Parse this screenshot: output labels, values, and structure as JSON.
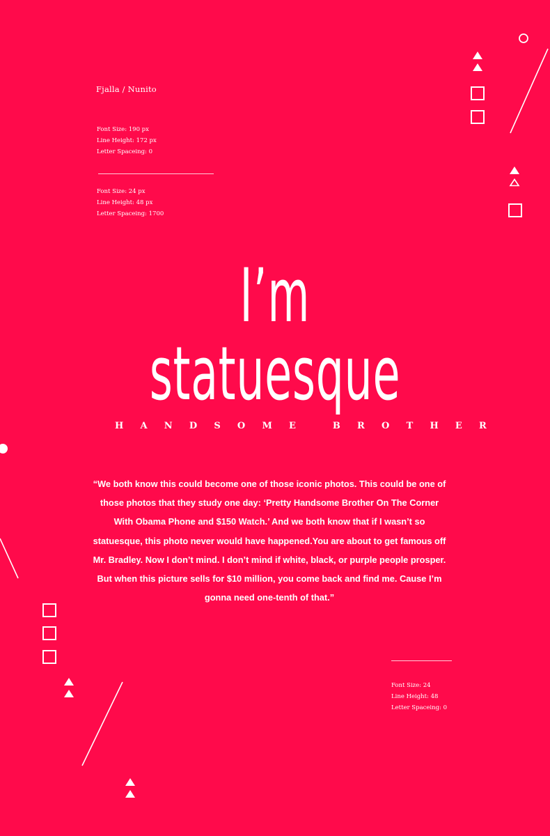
{
  "font_pair": "Fjalla / Nunito",
  "specs": {
    "headline": [
      "Font Size: 190 px",
      "Line Height: 172 px",
      "Letter Spaceing: 0"
    ],
    "subtitle": [
      "Font Size: 24 px",
      "Line Height: 48 px",
      "Letter Spaceing: 1700"
    ],
    "body": [
      "Font Size: 24",
      "Line Height: 48",
      "Letter Spaceing: 0"
    ]
  },
  "headline": {
    "line1": "I’m",
    "line2": "statuesque"
  },
  "subtitle": "HANDSOME BROTHER",
  "quote": "“We both know this could become one of those iconic photos. This could be one of those photos that they study one day: ‘Pretty Handsome Brother On The Corner With Obama Phone and $150 Watch.’ And we both know that if I wasn’t so statuesque, this photo never would have happened.You are about to get famous off Mr. Bradley. Now I don’t mind. I don’t mind if white, black, or purple people prosper. But when this picture sells for $10 million, you come back and find me. Cause I’m gonna need one-tenth of that.”",
  "colors": {
    "background": "#ff0a4b",
    "foreground": "#ffffff"
  },
  "decorations": [
    "triangle-icon",
    "square-icon",
    "circle-icon",
    "line"
  ]
}
